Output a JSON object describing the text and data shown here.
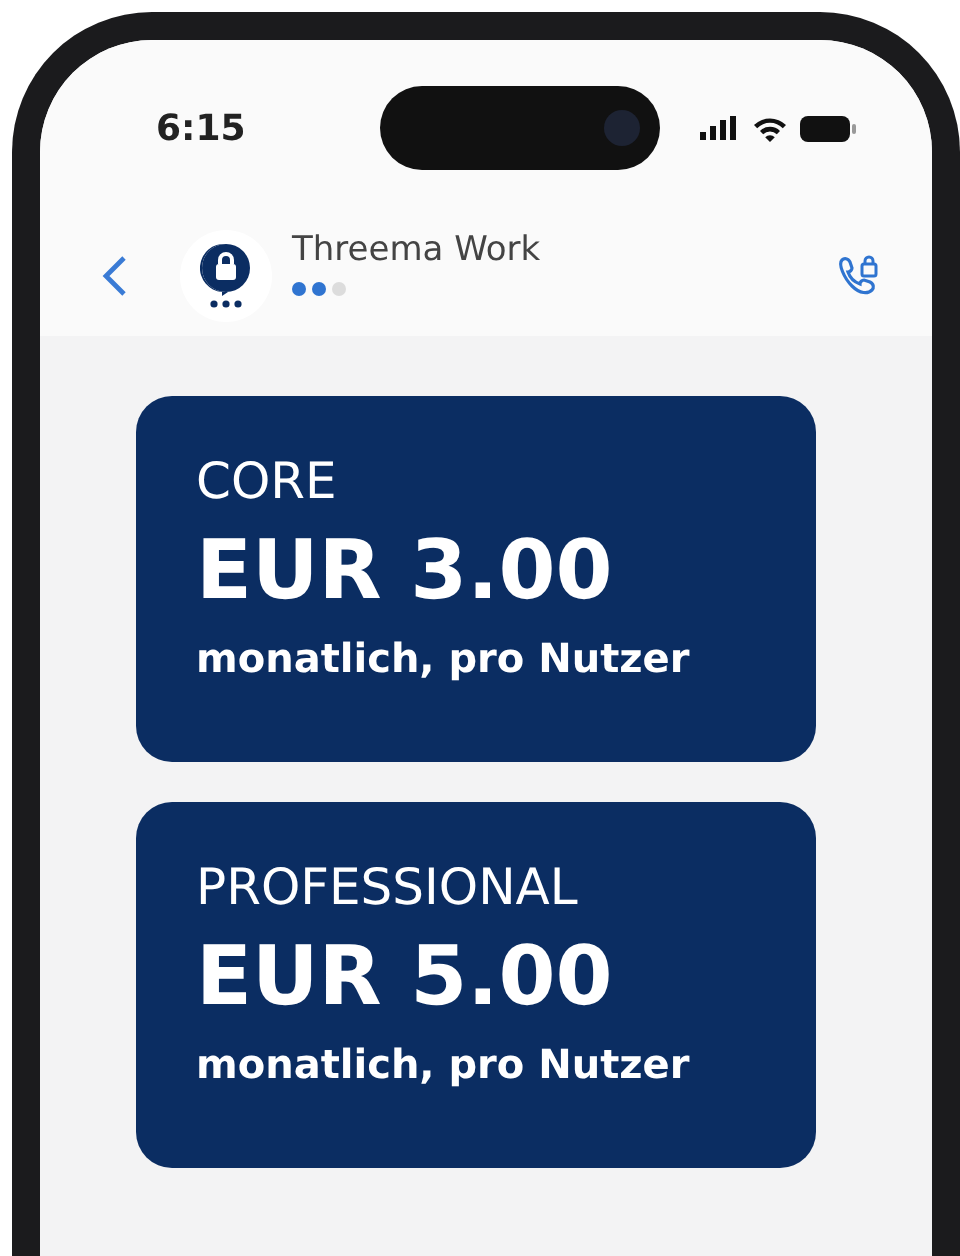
{
  "status_bar": {
    "time": "6:15"
  },
  "header": {
    "contact_name": "Threema Work",
    "stars": 2
  },
  "plans": [
    {
      "name": "CORE",
      "price": "EUR 3.00",
      "billing": "monatlich, pro Nutzer"
    },
    {
      "name": "PROFESSIONAL",
      "price": "EUR 5.00",
      "billing": "monatlich, pro Nutzer"
    }
  ]
}
